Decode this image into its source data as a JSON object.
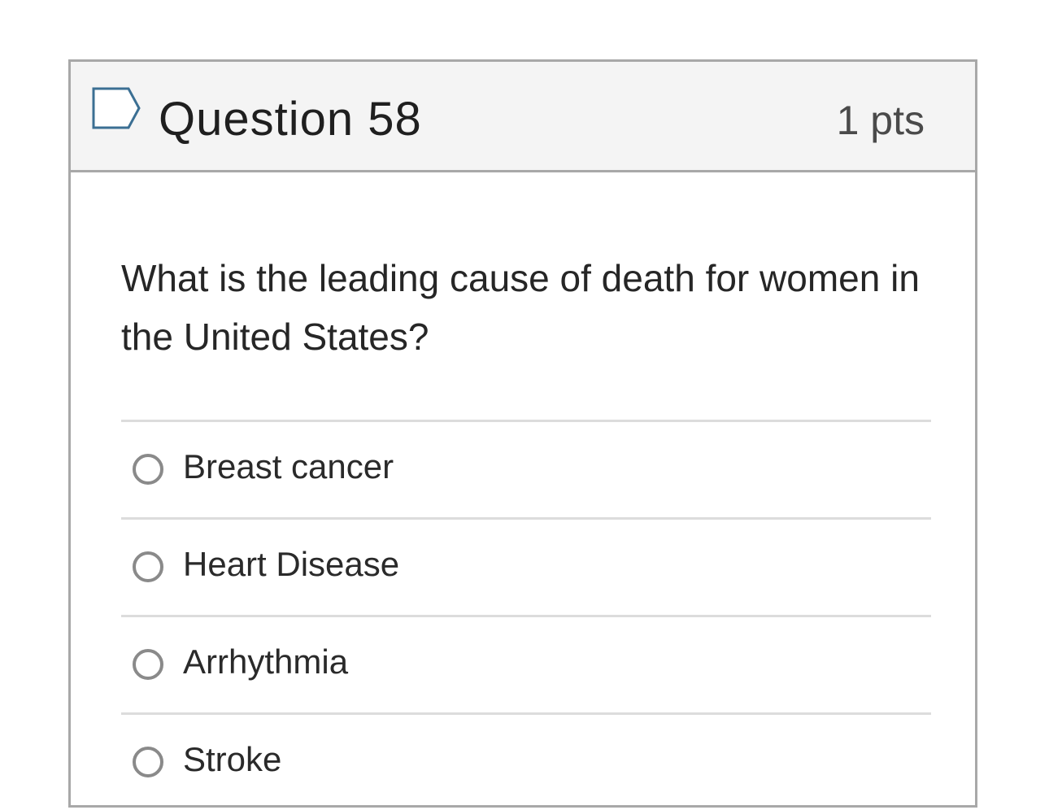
{
  "question": {
    "title": "Question 58",
    "points": "1 pts",
    "flag_icon": "flag-outline-icon",
    "text": "What is the leading cause of death for women in the United States?",
    "answers": [
      {
        "label": "Breast cancer",
        "selected": false
      },
      {
        "label": "Heart Disease",
        "selected": false
      },
      {
        "label": "Arrhythmia",
        "selected": false
      },
      {
        "label": "Stroke",
        "selected": false
      }
    ]
  },
  "colors": {
    "border": "#a8a8a8",
    "header_bg": "#f4f4f4",
    "flag_stroke": "#3b6f93",
    "divider": "#dcdcdc",
    "radio_border": "#8a8a8a"
  }
}
